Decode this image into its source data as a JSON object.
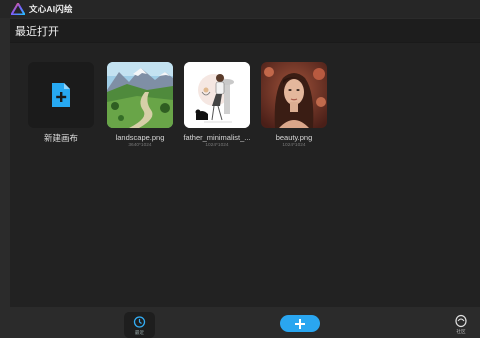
{
  "app": {
    "title": "文心AI闪绘"
  },
  "recent": {
    "title": "最近打开",
    "new_canvas": "新建画布",
    "files": [
      {
        "name": "landscape.png",
        "size": "3640*1024"
      },
      {
        "name": "father_minimalist_...",
        "size": "1024*1024"
      },
      {
        "name": "beauty.png",
        "size": "1024*1024"
      }
    ]
  },
  "bottom_nav": {
    "recent_label": "最近",
    "community_label": "社区"
  },
  "colors": {
    "accent": "#2aa6f0",
    "background": "#2b2b2b",
    "panel": "#222222"
  }
}
